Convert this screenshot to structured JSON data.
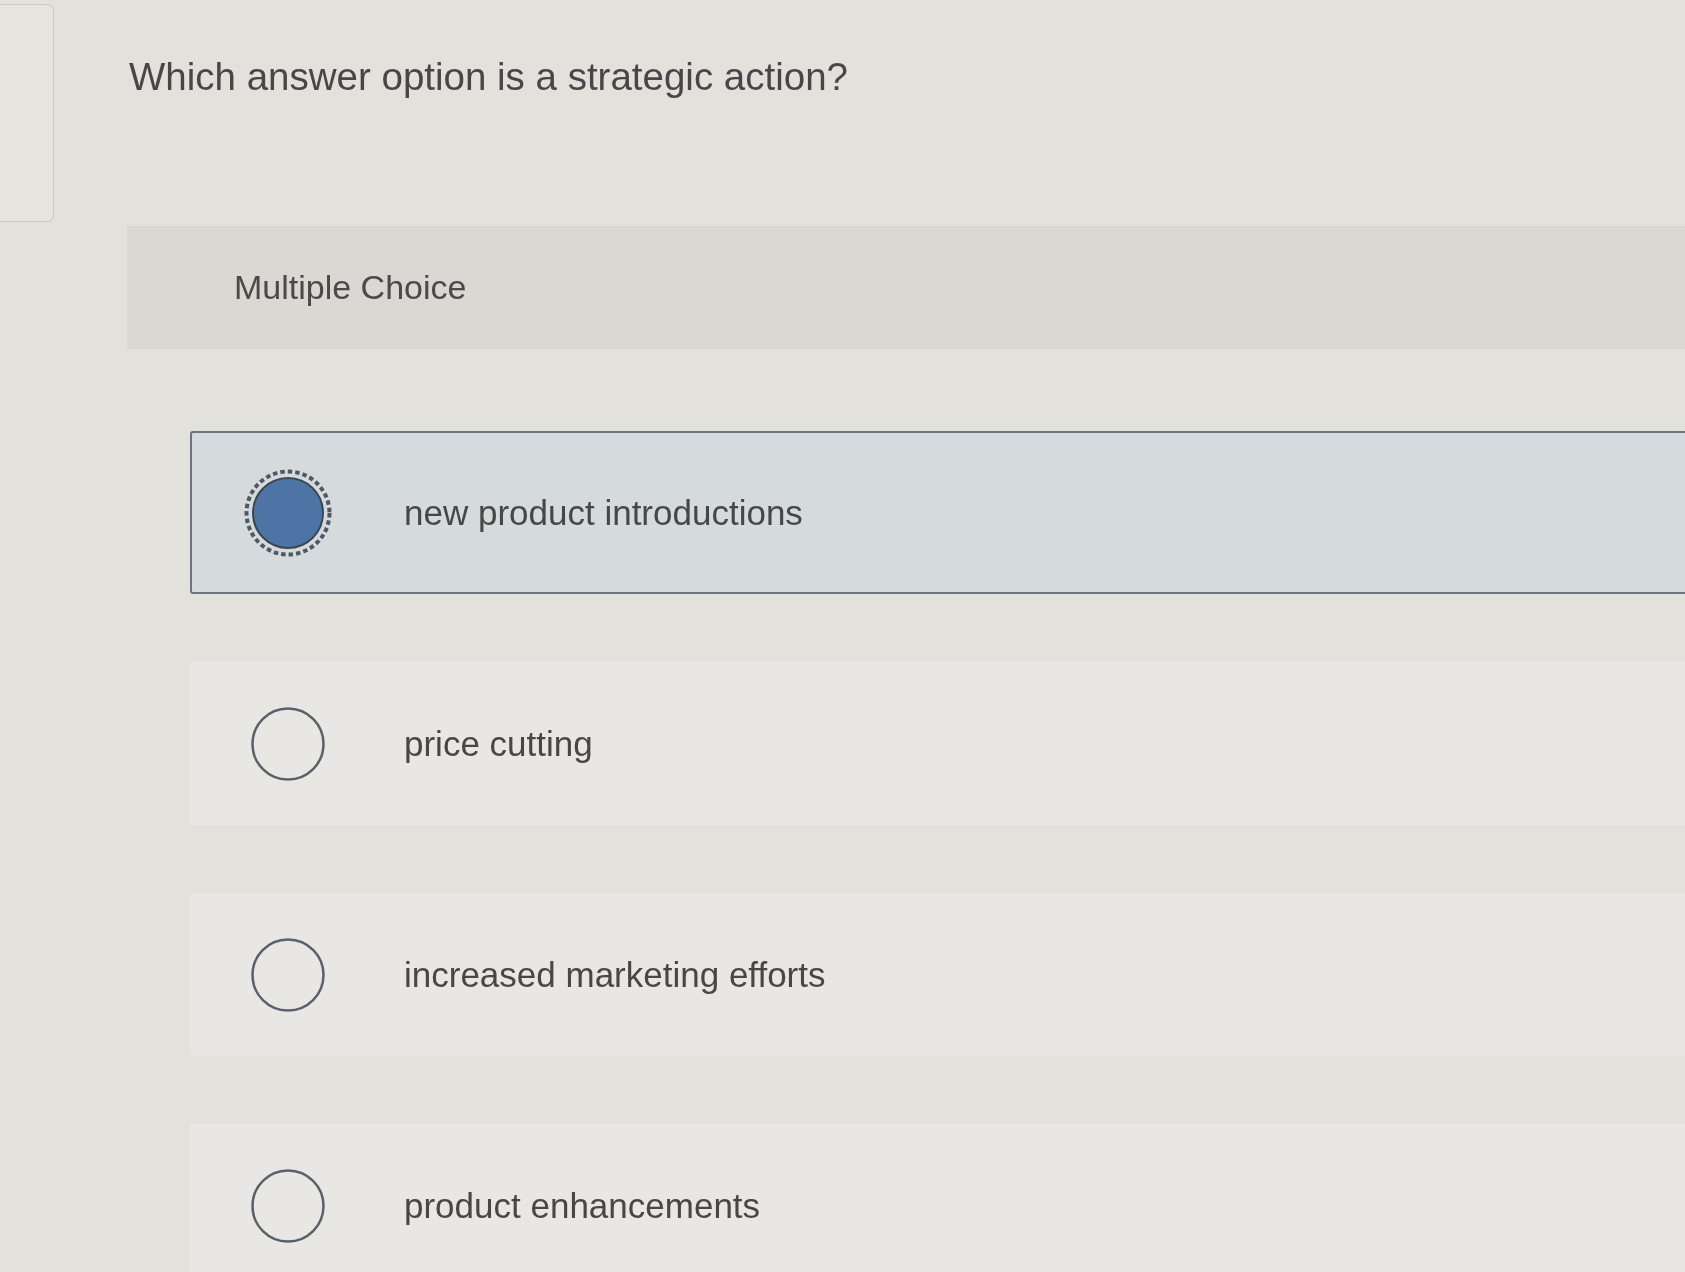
{
  "question": {
    "text": "Which answer option is a strategic action?"
  },
  "answer_area": {
    "label": "Multiple Choice",
    "options": [
      {
        "text": "new product introductions",
        "selected": true
      },
      {
        "text": "price cutting",
        "selected": false
      },
      {
        "text": "increased marketing efforts",
        "selected": false
      },
      {
        "text": "product enhancements",
        "selected": false
      }
    ]
  }
}
